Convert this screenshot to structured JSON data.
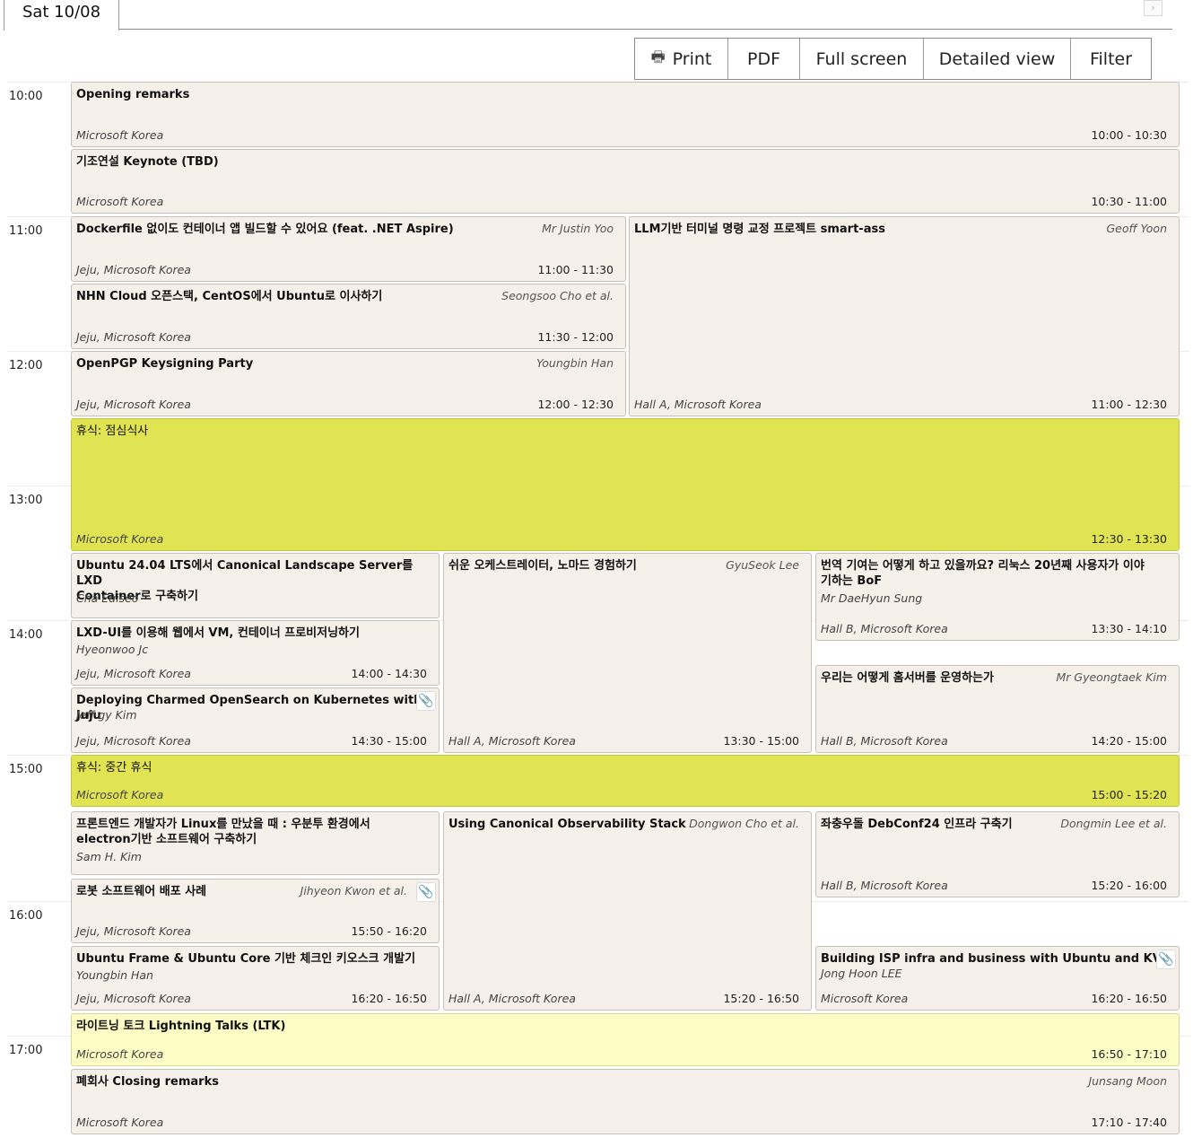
{
  "tab": {
    "label": "Sat 10/08",
    "next_icon": "chevron-right-icon"
  },
  "toolbar": {
    "print_icon": "printer-icon",
    "print": "Print",
    "pdf": "PDF",
    "fullscreen": "Full screen",
    "detailed": "Detailed view",
    "filter": "Filter"
  },
  "hours": [
    "10:00",
    "11:00",
    "12:00",
    "13:00",
    "14:00",
    "15:00",
    "16:00",
    "17:00"
  ],
  "colors": {
    "event_bg": "#f6f0ea",
    "break_bg": "#e0e352",
    "lightning_bg": "#fdfcc4",
    "attachment": "#2f6ed0"
  },
  "events": {
    "opening": {
      "title": "Opening remarks",
      "location": "Microsoft Korea",
      "time": "10:00 - 10:30"
    },
    "keynote": {
      "title": "기조연설 Keynote (TBD)",
      "location": "Microsoft Korea",
      "time": "10:30 - 11:00"
    },
    "dockerfile": {
      "title": "Dockerfile 없이도 컨테이너 앱 빌드할 수 있어요 (feat. .NET Aspire)",
      "speaker": "Mr Justin Yoo",
      "location": "Jeju, Microsoft Korea",
      "time": "11:00 - 11:30"
    },
    "llm": {
      "title": "LLM기반 터미널 명령 교정 프로젝트 smart-ass",
      "speaker": "Geoff Yoon",
      "location": "Hall A, Microsoft Korea",
      "time": "11:00 - 12:30"
    },
    "nhn": {
      "title": "NHN Cloud 오픈스택, CentOS에서 Ubuntu로 이사하기",
      "speaker": "Seongsoo Cho et al.",
      "location": "Jeju, Microsoft Korea",
      "time": "11:30 - 12:00"
    },
    "openpgp": {
      "title": "OpenPGP Keysigning Party",
      "speaker": "Youngbin Han",
      "location": "Jeju, Microsoft Korea",
      "time": "12:00 - 12:30"
    },
    "lunch": {
      "title": "휴식: 점심식사",
      "location": "Microsoft Korea",
      "time": "12:30 - 13:30"
    },
    "landscape": {
      "title_line1": "Ubuntu 24.04 LTS에서 Canonical Landscape Server를 LXD",
      "title_line2": "Container로 구축하기",
      "speaker": "Cha Euiseo"
    },
    "nomad": {
      "title": "쉬운 오케스트레이터, 노마드 경험하기",
      "speaker": "GyuSeok Lee",
      "location": "Hall A, Microsoft Korea",
      "time": "13:30 - 15:00"
    },
    "translation": {
      "title_line1": "번역 기여는 어떻게 하고 있을까요? 리눅스 20년째 사용자가 이야",
      "title_line2": "기하는 BoF",
      "speaker": "Mr DaeHyun Sung",
      "location": "Hall B, Microsoft Korea",
      "time": "13:30 - 14:10"
    },
    "lxdui": {
      "title": "LXD-UI를 이용해 웹에서 VM, 컨테이너 프로비저닝하기",
      "speaker": "Hyeonwoo Jc",
      "location": "Jeju, Microsoft Korea",
      "time": "14:00 - 14:30"
    },
    "homeserver": {
      "title": "우리는 어떻게 홈서버를 운영하는가",
      "speaker": "Mr Gyeongtaek Kim",
      "location": "Hall B, Microsoft Korea",
      "time": "14:20 - 15:00"
    },
    "opensearch": {
      "title": "Deploying Charmed OpenSearch on Kubernetes with Juju",
      "speaker": "Jeff gy Kim",
      "location": "Jeju, Microsoft Korea",
      "time": "14:30 - 15:00",
      "attachment_icon": "paperclip-icon"
    },
    "break2": {
      "title": "휴식: 중간 휴식",
      "location": "Microsoft Korea",
      "time": "15:00 - 15:20"
    },
    "frontend": {
      "title_line1": "프론트엔드 개발자가 Linux를 만났을 때 : 우분투 환경에서",
      "title_line2": "electron기반 소프트웨어 구축하기",
      "speaker": "Sam H. Kim"
    },
    "observability": {
      "title": "Using Canonical Observability Stack",
      "speaker": "Dongwon Cho et al.",
      "location": "Hall A, Microsoft Korea",
      "time": "15:20 - 16:50"
    },
    "debconf": {
      "title": "좌충우돌 DebConf24 인프라 구축기",
      "speaker": "Dongmin Lee et al.",
      "location": "Hall B, Microsoft Korea",
      "time": "15:20 - 16:00"
    },
    "robot": {
      "title": "로봇 소프트웨어 배포 사례",
      "speaker": "Jihyeon Kwon et al.",
      "location": "Jeju, Microsoft Korea",
      "time": "15:50 - 16:20",
      "attachment_icon": "paperclip-icon"
    },
    "kiosk": {
      "title": "Ubuntu Frame & Ubuntu Core 기반 체크인 키오스크 개발기",
      "speaker": "Youngbin Han",
      "location": "Jeju, Microsoft Korea",
      "time": "16:20 - 16:50"
    },
    "isp": {
      "title": "Building ISP infra and business with Ubuntu and KVM",
      "speaker": "Jong Hoon LEE",
      "location": "Microsoft Korea",
      "time": "16:20 - 16:50",
      "attachment_icon": "paperclip-icon"
    },
    "lightning": {
      "title": "라이트닝 토크 Lightning Talks (LTK)",
      "location": "Microsoft Korea",
      "time": "16:50 - 17:10"
    },
    "closing": {
      "title": "폐회사 Closing remarks",
      "speaker": "Junsang Moon",
      "location": "Microsoft Korea",
      "time": "17:10 - 17:40"
    }
  }
}
